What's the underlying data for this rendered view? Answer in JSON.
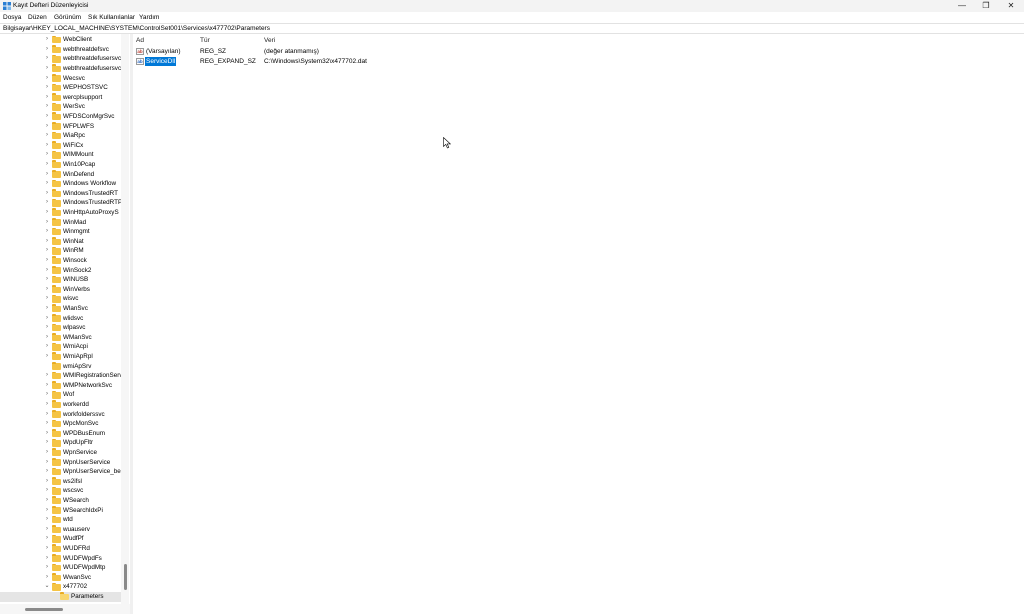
{
  "window": {
    "title": "Kayıt Defteri Düzenleyicisi",
    "minimize_glyph": "—",
    "maximize_glyph": "❐",
    "close_glyph": "✕"
  },
  "menu": [
    "Dosya",
    "Düzen",
    "Görünüm",
    "Sık Kullanılanlar",
    "Yardım"
  ],
  "address": "Bilgisayar\\HKEY_LOCAL_MACHINE\\SYSTEM\\ControlSet001\\Services\\x477702\\Parameters",
  "tree": {
    "items": [
      {
        "label": "WebClient",
        "expandable": true
      },
      {
        "label": "webthreatdefsvc",
        "expandable": true
      },
      {
        "label": "webthreatdefusersvc",
        "expandable": true
      },
      {
        "label": "webthreatdefusersvc",
        "expandable": true
      },
      {
        "label": "Wecsvc",
        "expandable": true
      },
      {
        "label": "WEPHOSTSVC",
        "expandable": true
      },
      {
        "label": "wercplsupport",
        "expandable": true
      },
      {
        "label": "WerSvc",
        "expandable": true
      },
      {
        "label": "WFDSConMgrSvc",
        "expandable": true
      },
      {
        "label": "WFPLWFS",
        "expandable": true
      },
      {
        "label": "WiaRpc",
        "expandable": true
      },
      {
        "label": "WiFiCx",
        "expandable": true
      },
      {
        "label": "WIMMount",
        "expandable": true
      },
      {
        "label": "Win10Pcap",
        "expandable": true
      },
      {
        "label": "WinDefend",
        "expandable": true
      },
      {
        "label": "Windows Workflow",
        "expandable": true
      },
      {
        "label": "WindowsTrustedRT",
        "expandable": true
      },
      {
        "label": "WindowsTrustedRTP",
        "expandable": true
      },
      {
        "label": "WinHttpAutoProxyS",
        "expandable": true
      },
      {
        "label": "WinMad",
        "expandable": true
      },
      {
        "label": "Winmgmt",
        "expandable": true
      },
      {
        "label": "WinNat",
        "expandable": true
      },
      {
        "label": "WinRM",
        "expandable": true
      },
      {
        "label": "Winsock",
        "expandable": true
      },
      {
        "label": "WinSock2",
        "expandable": true
      },
      {
        "label": "WINUSB",
        "expandable": true
      },
      {
        "label": "WinVerbs",
        "expandable": true
      },
      {
        "label": "wisvc",
        "expandable": true
      },
      {
        "label": "WlanSvc",
        "expandable": true
      },
      {
        "label": "wlidsvc",
        "expandable": true
      },
      {
        "label": "wlpasvc",
        "expandable": true
      },
      {
        "label": "WManSvc",
        "expandable": true
      },
      {
        "label": "WmiAcpi",
        "expandable": true
      },
      {
        "label": "WmiApRpl",
        "expandable": true
      },
      {
        "label": "wmiApSrv",
        "expandable": false
      },
      {
        "label": "WMIRegistrationServ",
        "expandable": true
      },
      {
        "label": "WMPNetworkSvc",
        "expandable": true
      },
      {
        "label": "Wof",
        "expandable": true
      },
      {
        "label": "workerdd",
        "expandable": true
      },
      {
        "label": "workfolderssvc",
        "expandable": true
      },
      {
        "label": "WpcMonSvc",
        "expandable": true
      },
      {
        "label": "WPDBusEnum",
        "expandable": true
      },
      {
        "label": "WpdUpFltr",
        "expandable": true
      },
      {
        "label": "WpnService",
        "expandable": true
      },
      {
        "label": "WpnUserService",
        "expandable": true
      },
      {
        "label": "WpnUserService_bea",
        "expandable": true
      },
      {
        "label": "ws2ifsl",
        "expandable": true
      },
      {
        "label": "wscsvc",
        "expandable": true
      },
      {
        "label": "WSearch",
        "expandable": true
      },
      {
        "label": "WSearchIdxPi",
        "expandable": true
      },
      {
        "label": "wtd",
        "expandable": true
      },
      {
        "label": "wuauserv",
        "expandable": true
      },
      {
        "label": "WudfPf",
        "expandable": true
      },
      {
        "label": "WUDFRd",
        "expandable": true
      },
      {
        "label": "WUDFWpdFs",
        "expandable": true
      },
      {
        "label": "WUDFWpdMtp",
        "expandable": true
      },
      {
        "label": "WwanSvc",
        "expandable": true
      },
      {
        "label": "x477702",
        "expandable": true,
        "expanded": true
      }
    ],
    "child": {
      "label": "Parameters",
      "selected": true
    }
  },
  "list": {
    "headers": {
      "name": "Ad",
      "type": "Tür",
      "data": "Veri"
    },
    "rows": [
      {
        "icon": "string-value-icon",
        "icon_text": "ab",
        "name": "(Varsayılan)",
        "type": "REG_SZ",
        "data": "(değer atanmamış)",
        "selected": false
      },
      {
        "icon": "expand-string-value-icon",
        "icon_text": "ab",
        "name": "ServiceDll",
        "type": "REG_EXPAND_SZ",
        "data": "C:\\Windows\\System32\\x477702.dat",
        "selected": true
      }
    ]
  }
}
